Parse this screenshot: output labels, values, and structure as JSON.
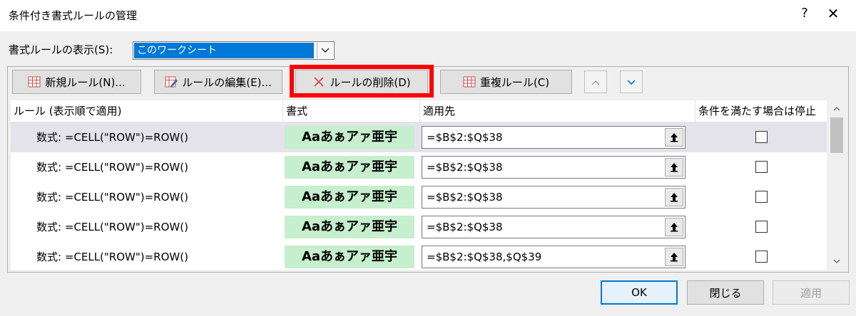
{
  "window": {
    "title": "条件付き書式ルールの管理",
    "help_label": "?",
    "close_label": "✕"
  },
  "show_rules": {
    "label": "書式ルールの表示(S):",
    "selected": "このワークシート"
  },
  "toolbar": {
    "new_rule": "新規ルール(N)...",
    "edit_rule": "ルールの編集(E)...",
    "delete_rule": "ルールの削除(D)",
    "duplicate_rule": "重複ルール(C)",
    "move_up_icon": "chevron-up-icon",
    "move_down_icon": "chevron-down-icon"
  },
  "table": {
    "headers": {
      "rule": "ルール (表示順で適用)",
      "format": "書式",
      "applies_to": "適用先",
      "stop_if_true": "条件を満たす場合は停止"
    },
    "rows": [
      {
        "rule": "数式: =CELL(\"ROW\")=ROW()",
        "sample": "Aaあぁアァ亜宇",
        "applies_to": "=$B$2:$Q$38",
        "stop": false,
        "selected": true
      },
      {
        "rule": "数式: =CELL(\"ROW\")=ROW()",
        "sample": "Aaあぁアァ亜宇",
        "applies_to": "=$B$2:$Q$38",
        "stop": false,
        "selected": false
      },
      {
        "rule": "数式: =CELL(\"ROW\")=ROW()",
        "sample": "Aaあぁアァ亜宇",
        "applies_to": "=$B$2:$Q$38",
        "stop": false,
        "selected": false
      },
      {
        "rule": "数式: =CELL(\"ROW\")=ROW()",
        "sample": "Aaあぁアァ亜宇",
        "applies_to": "=$B$2:$Q$38",
        "stop": false,
        "selected": false
      },
      {
        "rule": "数式: =CELL(\"ROW\")=ROW()",
        "sample": "Aaあぁアァ亜宇",
        "applies_to": "=$B$2:$Q$38,$Q$39",
        "stop": false,
        "selected": false
      }
    ]
  },
  "footer": {
    "ok": "OK",
    "close": "閉じる",
    "apply": "適用"
  },
  "colors": {
    "highlight": "#ff0000",
    "accent": "#0078d7",
    "sample_fill": "#c6efce"
  }
}
